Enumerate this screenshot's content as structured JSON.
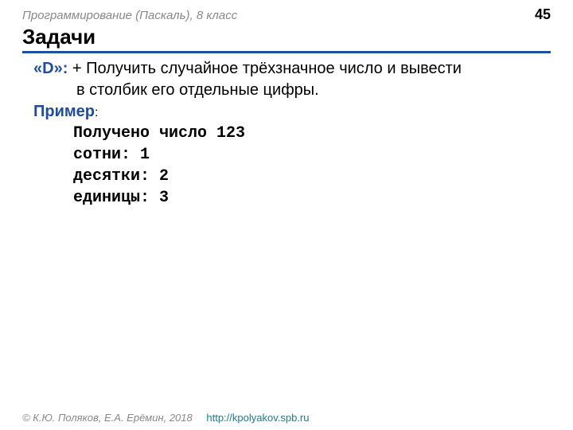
{
  "header": {
    "breadcrumb": "Программирование (Паскаль), 8 класс",
    "page_number": "45"
  },
  "title": "Задачи",
  "task": {
    "label": "«D»:",
    "line1": " + Получить случайное трёхзначное число и вывести",
    "line2": "в столбик его отдельные цифры."
  },
  "example": {
    "label": "Пример",
    "colon": ":",
    "lines": [
      "Получено число 123",
      "сотни: 1",
      "десятки: 2",
      "единицы: 3"
    ]
  },
  "footer": {
    "copyright": "© К.Ю. Поляков, Е.А. Ерёмин, 2018",
    "link": "http://kpolyakov.spb.ru"
  }
}
